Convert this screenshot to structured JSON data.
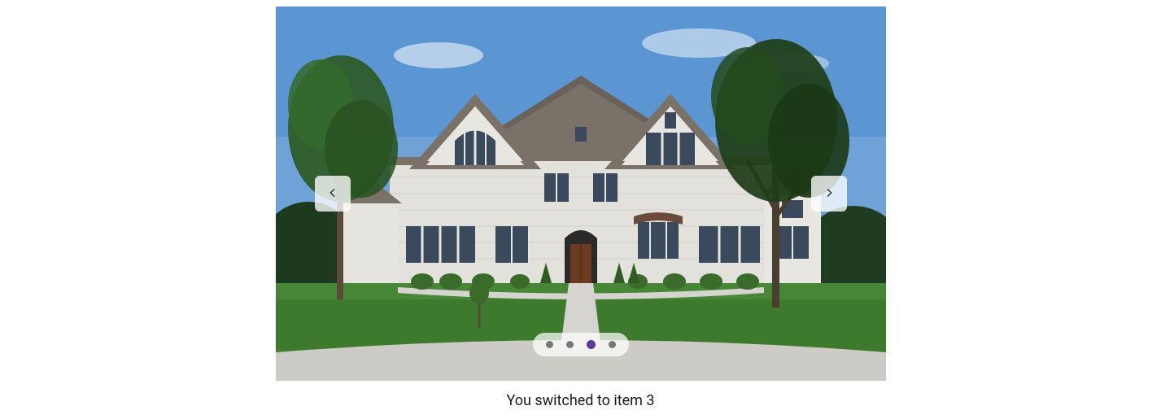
{
  "carousel": {
    "total_items": 4,
    "active_index": 2,
    "prev_label": "Previous",
    "next_label": "Next",
    "dots": [
      {
        "active": false
      },
      {
        "active": false
      },
      {
        "active": true
      },
      {
        "active": false
      }
    ]
  },
  "status_text": "You switched to item 3",
  "colors": {
    "dot_inactive": "#777777",
    "dot_active": "#5e3b9e",
    "nav_bg": "rgba(255,255,255,0.78)"
  }
}
